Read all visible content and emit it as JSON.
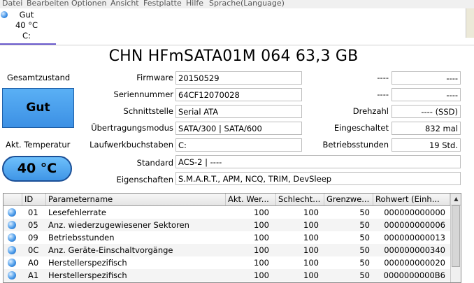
{
  "menu": [
    "Datei",
    "Bearbeiten",
    "Optionen",
    "Ansicht",
    "Festplatte",
    "Hilfe",
    "Sprache(Language)"
  ],
  "tab": {
    "status": "Gut",
    "temp": "40 °C",
    "drive": "C:"
  },
  "title": "CHN HFmSATA01M 064 63,3 GB",
  "health": {
    "label": "Gesamtzustand",
    "value": "Gut"
  },
  "temperature": {
    "label": "Akt. Temperatur",
    "value": "40 °C"
  },
  "info": {
    "firmware": {
      "label": "Firmware",
      "value": "20150529"
    },
    "serial": {
      "label": "Seriennummer",
      "value": "64CF12070028"
    },
    "interface": {
      "label": "Schnittstelle",
      "value": "Serial ATA"
    },
    "transfer": {
      "label": "Übertragungsmodus",
      "value": "SATA/300 | SATA/600"
    },
    "letters": {
      "label": "Laufwerkbuchstaben",
      "value": "C:"
    },
    "standard": {
      "label": "Standard",
      "value": "ACS-2 | ----"
    },
    "features": {
      "label": "Eigenschaften",
      "value": "S.M.A.R.T., APM, NCQ, TRIM, DevSleep"
    }
  },
  "right": {
    "r1": {
      "label": "----",
      "value": "----"
    },
    "r2": {
      "label": "----",
      "value": "----"
    },
    "rpm": {
      "label": "Drehzahl",
      "value": "---- (SSD)"
    },
    "power_on_count": {
      "label": "Eingeschaltet",
      "value": "832 mal"
    },
    "power_on_hours": {
      "label": "Betriebsstunden",
      "value": "19 Std."
    }
  },
  "table": {
    "headers": [
      "",
      "ID",
      "Parametername",
      "Akt. Wer...",
      "Schlecht...",
      "Grenzwe...",
      "Rohwert (Einh..."
    ],
    "rows": [
      [
        "01",
        "Lesefehlerrate",
        "100",
        "100",
        "50",
        "000000000000"
      ],
      [
        "05",
        "Anz. wiederzugewiesener Sektoren",
        "100",
        "100",
        "50",
        "000000000006"
      ],
      [
        "09",
        "Betriebsstunden",
        "100",
        "100",
        "50",
        "000000000013"
      ],
      [
        "0C",
        "Anz. Geräte-Einschaltvorgänge",
        "100",
        "100",
        "50",
        "000000000340"
      ],
      [
        "A0",
        "Herstellerspezifisch",
        "100",
        "100",
        "50",
        "000000000020"
      ],
      [
        "A1",
        "Herstellerspezifisch",
        "100",
        "100",
        "50",
        "0000000000B6"
      ]
    ]
  },
  "colors": {
    "good": "#3c90e4",
    "tab_underline": "#6a5acd"
  }
}
